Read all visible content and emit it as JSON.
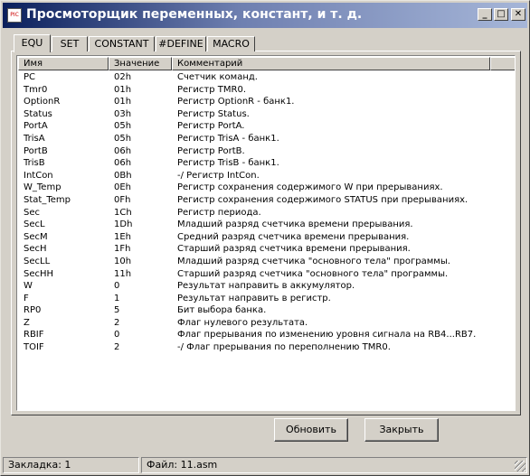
{
  "window": {
    "title": "Просмоторщик переменных, констант, и т. д.",
    "app_icon": "pic-icon",
    "controls": {
      "minimize": "_",
      "maximize": "□",
      "close": "✕"
    }
  },
  "tabs": [
    "EQU",
    "SET",
    "CONSTANT",
    "#DEFINE",
    "MACRO"
  ],
  "active_tab": "EQU",
  "columns": [
    "Имя",
    "Значение",
    "Комментарий"
  ],
  "rows": [
    {
      "name": "PC",
      "value": "02h",
      "comment": "Счетчик команд."
    },
    {
      "name": "Tmr0",
      "value": "01h",
      "comment": "Регистр TMR0."
    },
    {
      "name": "OptionR",
      "value": "01h",
      "comment": "Регистр OptionR - банк1."
    },
    {
      "name": "Status",
      "value": "03h",
      "comment": "Регистр Status."
    },
    {
      "name": "PortA",
      "value": "05h",
      "comment": "Регистр PortA."
    },
    {
      "name": "TrisA",
      "value": "05h",
      "comment": "Регистр TrisA - банк1."
    },
    {
      "name": "PortB",
      "value": "06h",
      "comment": "Регистр PortB."
    },
    {
      "name": "TrisB",
      "value": "06h",
      "comment": "Регистр TrisB - банк1."
    },
    {
      "name": "IntCon",
      "value": "0Bh",
      "comment": "-/ Регистр IntCon."
    },
    {
      "name": "W_Temp",
      "value": "0Eh",
      "comment": "Регистр сохранения содержимого W при прерываниях."
    },
    {
      "name": "Stat_Temp",
      "value": "0Fh",
      "comment": "Регистр сохранения содержимого STATUS при прерываниях."
    },
    {
      "name": "Sec",
      "value": "1Ch",
      "comment": "Регистр периода."
    },
    {
      "name": "SecL",
      "value": "1Dh",
      "comment": "Младший разряд счетчика времени прерывания."
    },
    {
      "name": "SecM",
      "value": "1Eh",
      "comment": "Средний разряд счетчика времени прерывания."
    },
    {
      "name": "SecH",
      "value": "1Fh",
      "comment": "Старший разряд счетчика времени прерывания."
    },
    {
      "name": "SecLL",
      "value": "10h",
      "comment": "Младший разряд счетчика \"основного тела\" программы."
    },
    {
      "name": "SecHH",
      "value": "11h",
      "comment": "Старший разряд счетчика \"основного тела\" программы."
    },
    {
      "name": "W",
      "value": "0",
      "comment": "Результат направить в аккумулятор."
    },
    {
      "name": "F",
      "value": "1",
      "comment": "Результат направить в регистр."
    },
    {
      "name": "RP0",
      "value": "5",
      "comment": "Бит выбора банка."
    },
    {
      "name": "Z",
      "value": "2",
      "comment": "Флаг нулевого результата."
    },
    {
      "name": "RBIF",
      "value": "0",
      "comment": "Флаг прерывания по изменению уровня сигнала на RB4...RB7."
    },
    {
      "name": "TOIF",
      "value": "2",
      "comment": "-/ Флаг прерывания по переполнению TMR0."
    }
  ],
  "buttons": {
    "refresh": "Обновить",
    "close": "Закрыть"
  },
  "status": {
    "tab_label": "Закладка:  1",
    "file_label": "Файл:  11.asm"
  }
}
